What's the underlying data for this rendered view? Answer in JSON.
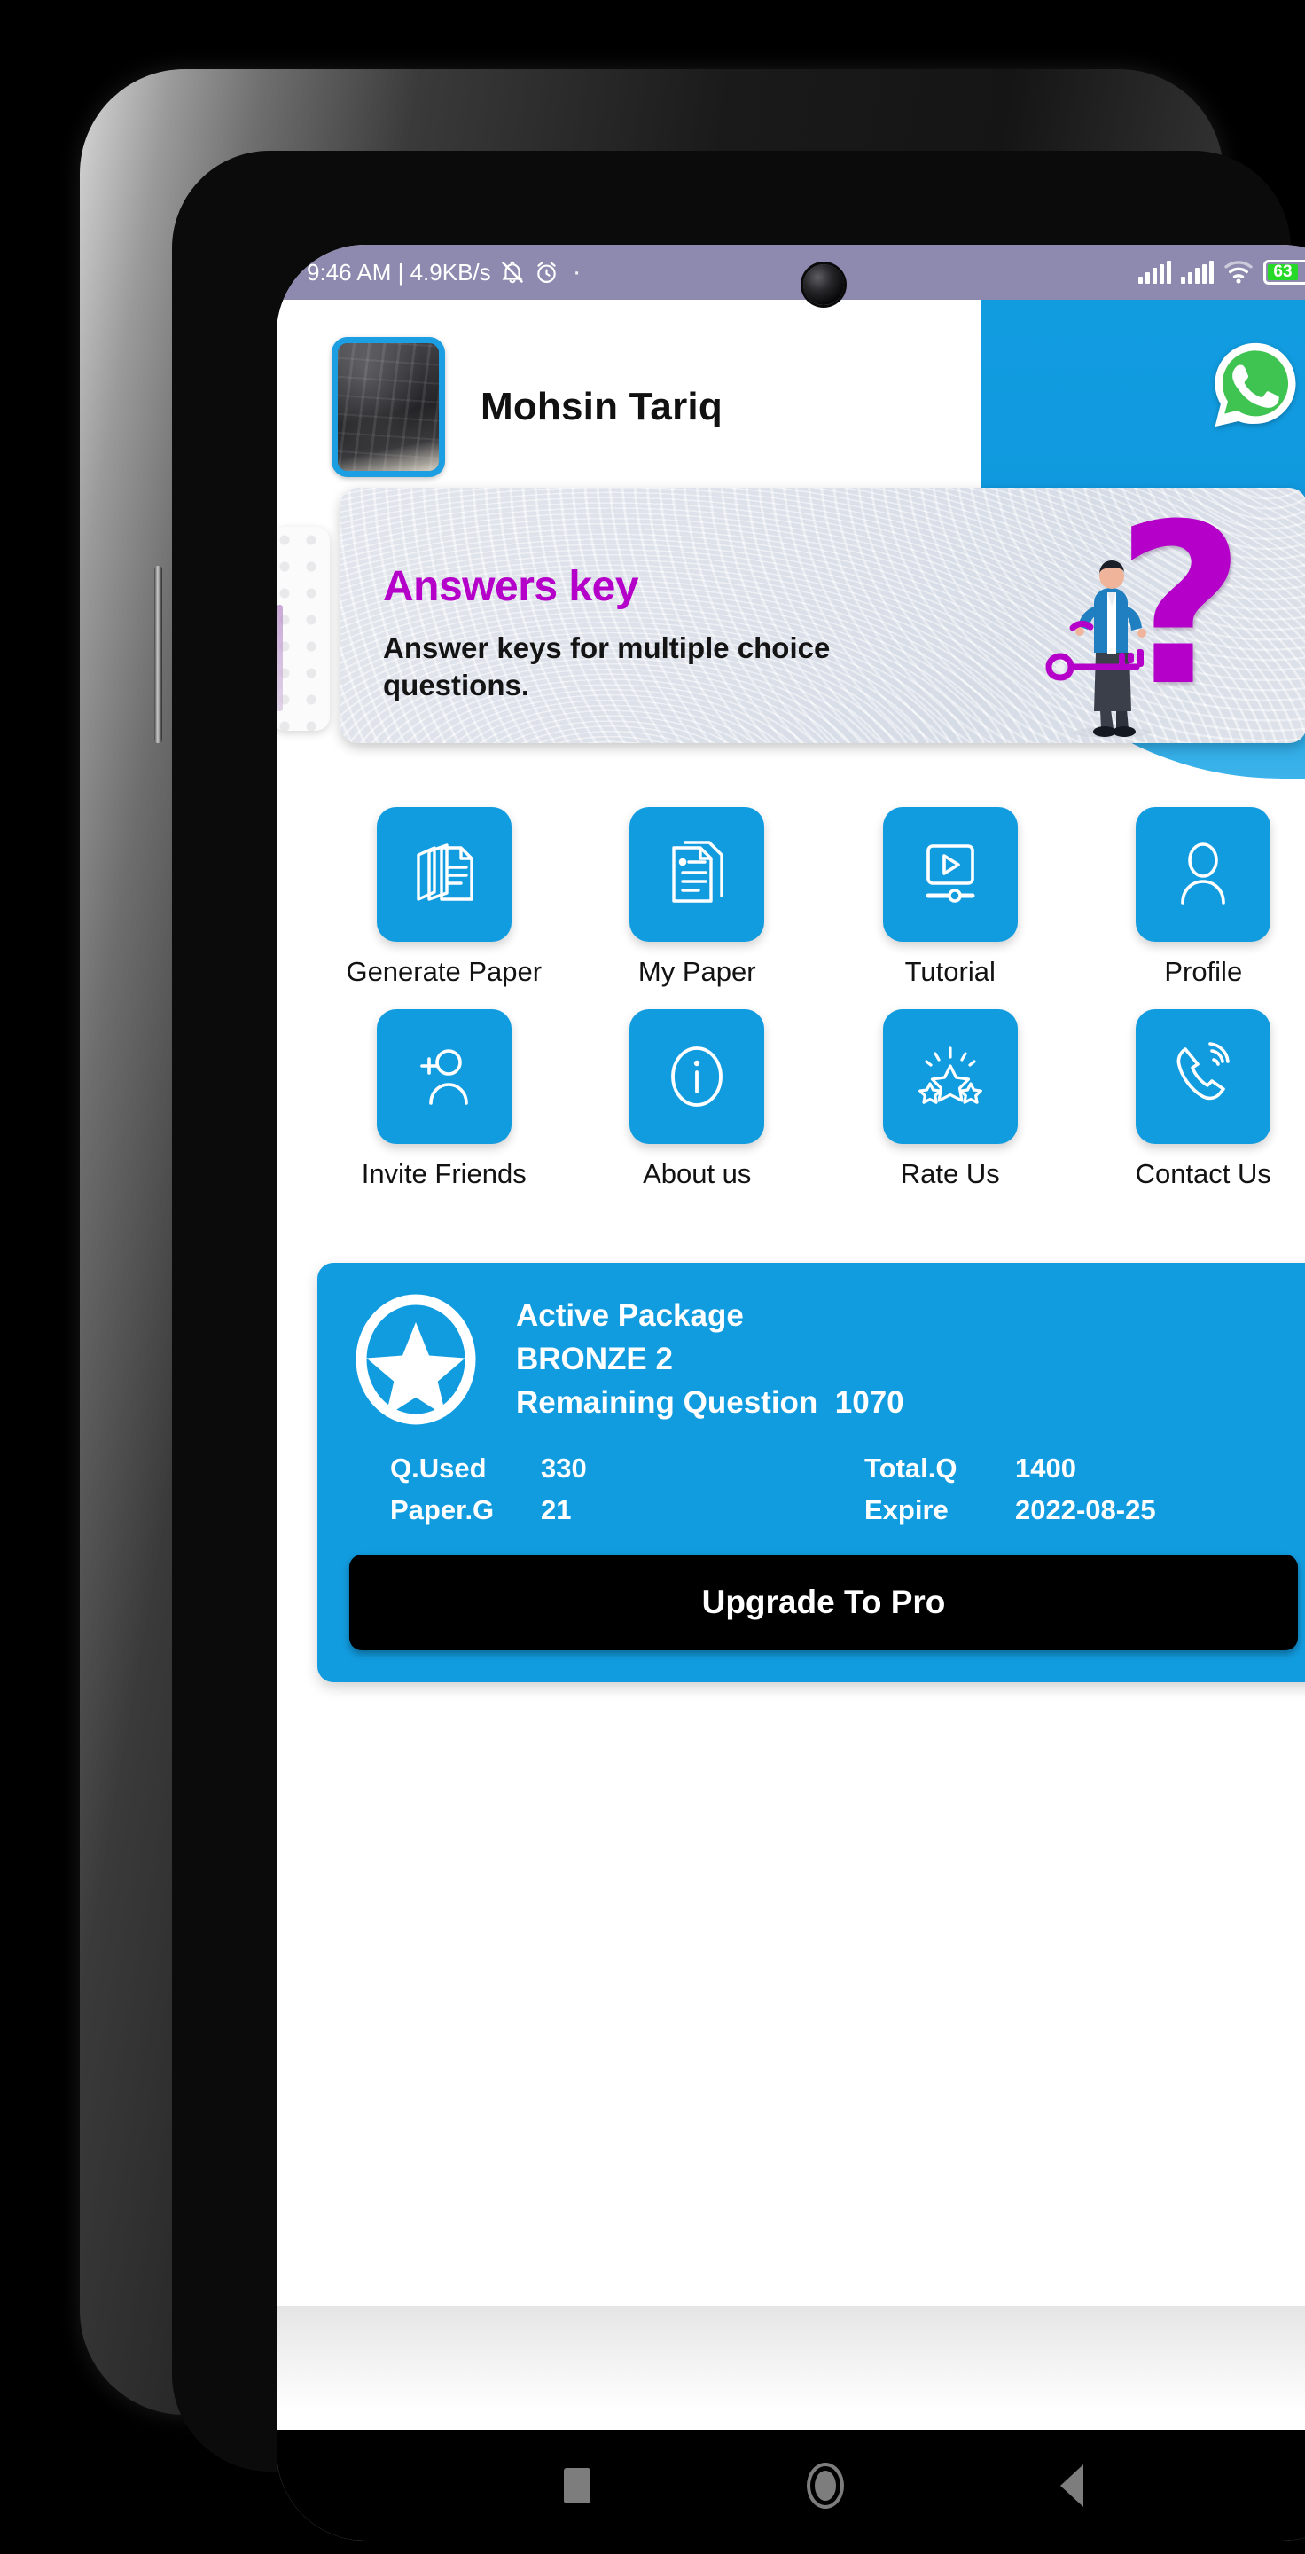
{
  "statusbar": {
    "time_and_speed": "9:46 AM | 4.9KB/s",
    "mute_icon": "bell-mute-icon",
    "alarm_icon": "alarm-clock-icon",
    "dot": "·",
    "signal_icon": "signal-bars-icon",
    "signal2_icon": "signal-bars-icon",
    "wifi_icon": "wifi-icon",
    "battery_percent": "63",
    "charging_icon": "charging-bolt-icon",
    "bg_color": "#8e8aaf"
  },
  "header": {
    "avatar_name": "profile-avatar",
    "user_name": "Mohsin Tariq",
    "whatsapp_label": "whatsapp-icon",
    "blob_color": "#129ce0"
  },
  "banner": {
    "title": "Answers key",
    "subtitle": "Answer keys for multiple choice questions.",
    "question_mark": "?",
    "title_color": "#b400c8"
  },
  "grid": {
    "items": [
      {
        "label": "Generate Paper",
        "icon": "stacked-documents-icon"
      },
      {
        "label": "My Paper",
        "icon": "document-list-icon"
      },
      {
        "label": "Tutorial",
        "icon": "video-player-icon"
      },
      {
        "label": "Profile",
        "icon": "person-icon"
      },
      {
        "label": "Invite Friends",
        "icon": "add-person-icon"
      },
      {
        "label": "About us",
        "icon": "info-icon"
      },
      {
        "label": "Rate Us",
        "icon": "stars-icon"
      },
      {
        "label": "Contact Us",
        "icon": "phone-call-icon"
      }
    ]
  },
  "package": {
    "star_icon": "star-in-circle-icon",
    "heading": "Active Package",
    "plan": "BRONZE 2",
    "remaining_label": "Remaining Question",
    "remaining_value": "1070",
    "stats": [
      {
        "key": "Q.Used",
        "value": "330"
      },
      {
        "key": "Total.Q",
        "value": "1400"
      },
      {
        "key": "Paper.G",
        "value": "21"
      },
      {
        "key": "Expire",
        "value": "2022-08-25"
      }
    ],
    "upgrade_label": "Upgrade To Pro",
    "card_color": "#129ce0",
    "upgrade_color": "#000000"
  },
  "navbar": {
    "recents_icon": "square-recents-icon",
    "home_icon": "circle-home-icon",
    "back_icon": "triangle-back-icon"
  }
}
